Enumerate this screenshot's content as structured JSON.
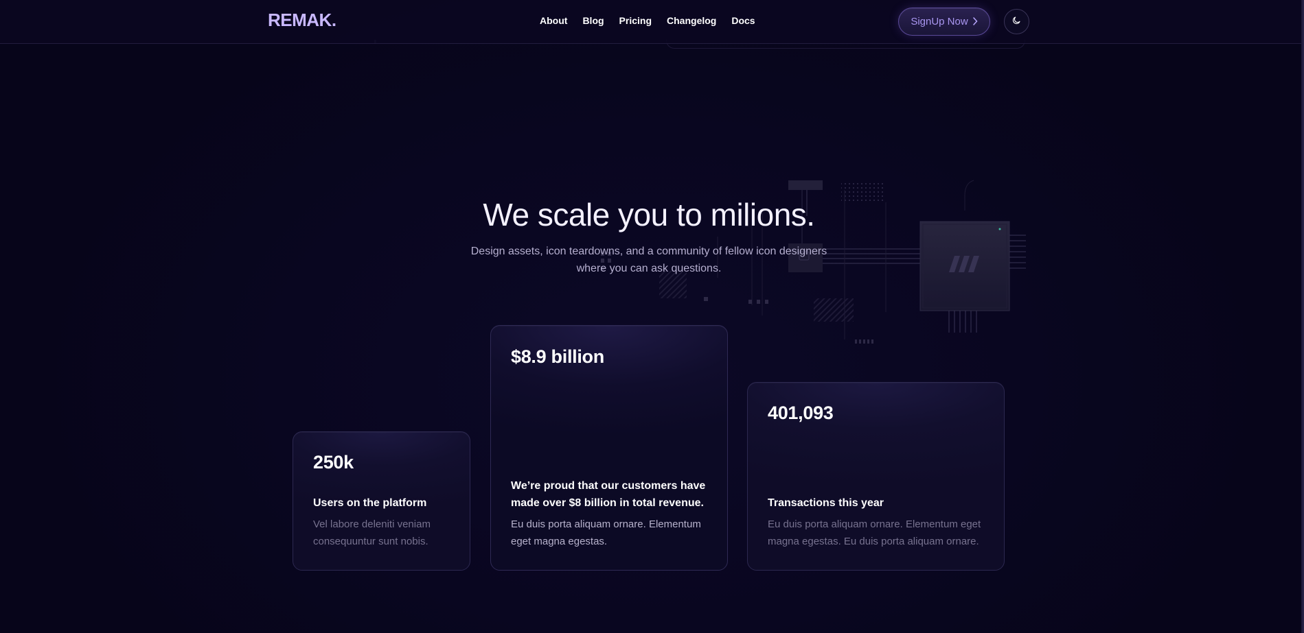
{
  "nav": {
    "logo": "REMAK.",
    "links": [
      "About",
      "Blog",
      "Pricing",
      "Changelog",
      "Docs"
    ],
    "signup_label": "SignUp Now",
    "theme_icon": "moon-icon"
  },
  "hero": {
    "title": "We scale you to milions.",
    "subtitle_line1": "Design assets, icon teardowns, and a community of fellow icon designers",
    "subtitle_line2": "where you can ask questions."
  },
  "stats": [
    {
      "value": "250k",
      "heading": "Users on the platform",
      "description_line1": "Vel labore deleniti veniam",
      "description_line2": "consequuntur sunt nobis."
    },
    {
      "value": "$8.9 billion",
      "heading_line1": "We’re proud that our customers have",
      "heading_line2": "made over $8 billion in total revenue.",
      "description_line1": "Eu duis porta aliquam ornare. Elementum",
      "description_line2": "eget magna egestas."
    },
    {
      "value": "401,093",
      "heading": "Transactions this year",
      "description_line1": "Eu duis porta aliquam ornare. Elementum eget",
      "description_line2": "magna egestas. Eu duis porta aliquam ornare."
    }
  ],
  "colors": {
    "background": "#0a0721",
    "logo": "#c9b8ff",
    "accent": "#a996f0",
    "card_border": "#2c2850"
  }
}
